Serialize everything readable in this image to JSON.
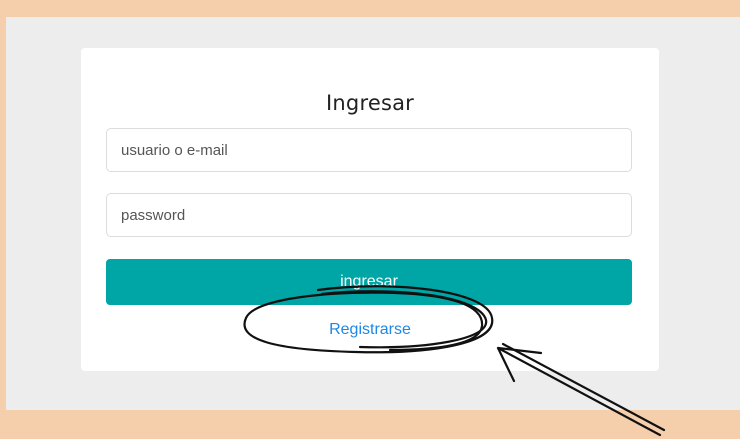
{
  "login": {
    "title": "Ingresar",
    "username_placeholder": "usuario o e-mail",
    "password_placeholder": "password",
    "submit_label": "ingresar",
    "register_link": "Registrarse"
  },
  "colors": {
    "page_background": "#f5cfac",
    "panel_background": "#ededed",
    "button": "#00a5a6",
    "link": "#1e88e5"
  },
  "annotation": {
    "shapes": [
      "hand-drawn-circle",
      "hand-drawn-arrow"
    ]
  }
}
